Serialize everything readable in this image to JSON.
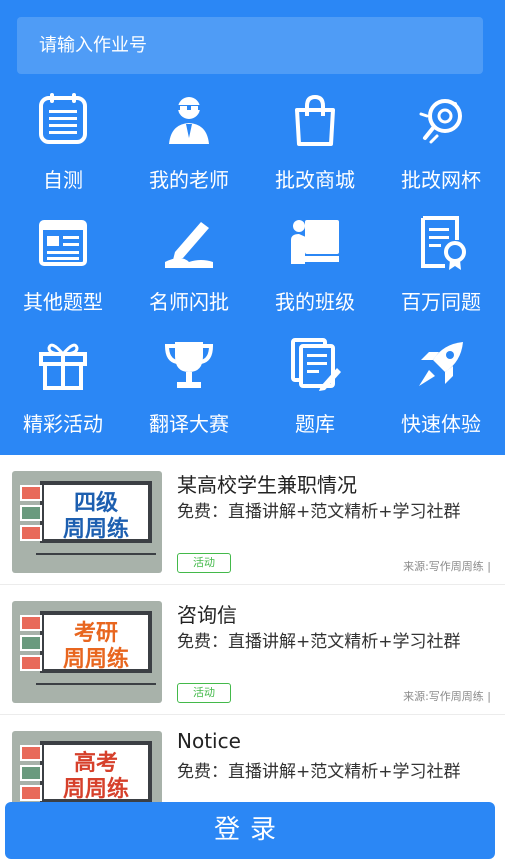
{
  "search": {
    "placeholder": "请输入作业号"
  },
  "grid": [
    {
      "label": "自测",
      "icon": "notepad-icon"
    },
    {
      "label": "我的老师",
      "icon": "teacher-icon"
    },
    {
      "label": "批改商城",
      "icon": "shopping-bag-icon"
    },
    {
      "label": "批改网杯",
      "icon": "trophy-badge-icon"
    },
    {
      "label": "其他题型",
      "icon": "window-list-icon"
    },
    {
      "label": "名师闪批",
      "icon": "pencil-icon"
    },
    {
      "label": "我的班级",
      "icon": "classroom-icon"
    },
    {
      "label": "百万同题",
      "icon": "certificate-icon"
    },
    {
      "label": "精彩活动",
      "icon": "gift-icon"
    },
    {
      "label": "翻译大赛",
      "icon": "cup-icon"
    },
    {
      "label": "题库",
      "icon": "documents-edit-icon"
    },
    {
      "label": "快速体验",
      "icon": "rocket-icon"
    }
  ],
  "list": [
    {
      "title": "某高校学生兼职情况",
      "desc": "免费：直播讲解+范文精析+学习社群",
      "tag": "活动",
      "source": "来源:写作周周练 |",
      "thumb_line1": "四级",
      "thumb_line2": "周周练",
      "thumb_color": "#1d5fb0"
    },
    {
      "title": "咨询信",
      "desc": "免费：直播讲解+范文精析+学习社群",
      "tag": "活动",
      "source": "来源:写作周周练 |",
      "thumb_line1": "考研",
      "thumb_line2": "周周练",
      "thumb_color": "#e8661f"
    },
    {
      "title": "Notice",
      "desc": "免费：直播讲解+范文精析+学习社群",
      "tag": "",
      "source": "",
      "thumb_line1": "高考",
      "thumb_line2": "周周练",
      "thumb_color": "#d6402b"
    }
  ],
  "login": {
    "label": "登录"
  },
  "colors": {
    "primary": "#2b87f5",
    "tag_green": "#43b94a"
  }
}
